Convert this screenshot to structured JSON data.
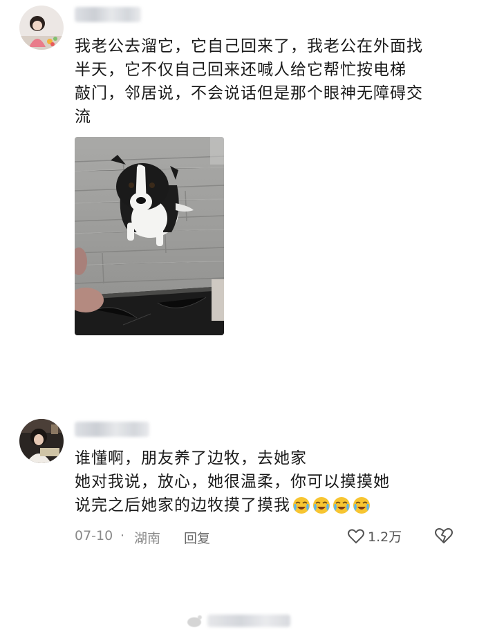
{
  "post": {
    "text": "我老公去溜它，它自己回来了，我老公在外面找\n半天，它不仅自己回来还喊人给它帮忙按电梯\n敲门，邻居说，不会说话但是那个眼神无障碍交\n流",
    "photo_subject": "border collie dog sitting on wood-grain tile floor"
  },
  "reply": {
    "text": "谁懂啊，朋友养了边牧，去她家\n她对我说，放心，她很温柔，你可以摸摸她\n说完之后她家的边牧摸了摸我",
    "emoji": [
      "crying-laughing",
      "crying-laughing",
      "crying-laughing",
      "crying-laughing"
    ],
    "date": "07-10",
    "separator": "·",
    "location": "湖南",
    "reply_label": "回复",
    "like_count": "1.2万"
  },
  "colors": {
    "text": "#1a1a1a",
    "meta": "#8a8a8a",
    "background": "#ffffff"
  }
}
